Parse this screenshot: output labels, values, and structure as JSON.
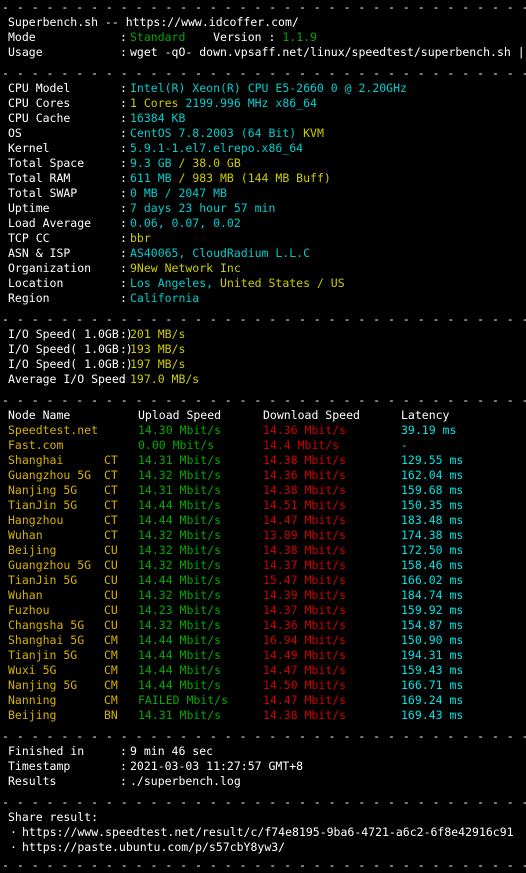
{
  "terminal": {
    "separator": "- - - - - - - - - - - - - - - - - - - - - - - - - - - - - - - - - - - - - -",
    "colors": {
      "background": "#000000",
      "foreground": "#ffffff",
      "cyan": "#00cdcd",
      "yellow": "#cdcd00",
      "green": "#00aa00",
      "red": "#cd0000",
      "bright_cyan": "#00e5e5",
      "node_name": "#d7b100"
    }
  },
  "header": {
    "title": "Superbench.sh -- https://www.idcoffer.com/",
    "mode_label": "Mode",
    "mode_value": "Standard",
    "version_label": "Version",
    "version_value": "1.1.9",
    "usage_label": "Usage",
    "usage_value": "wget -qO- down.vpsaff.net/linux/speedtest/superbench.sh | bash"
  },
  "sysinfo": [
    {
      "label": "CPU Model",
      "value_cyan": "Intel(R) Xeon(R) CPU E5-2660 0 @ 2.20GHz",
      "value_yellow": ""
    },
    {
      "label": "CPU Cores",
      "value_cyan": "",
      "value_yellow": "1 Cores",
      "value_cyan2": " 2199.996 MHz x86_64"
    },
    {
      "label": "CPU Cache",
      "value_cyan": "16384 KB",
      "value_yellow": ""
    },
    {
      "label": "OS",
      "value_cyan": "CentOS 7.8.2003 (64 Bit) ",
      "value_yellow": "KVM"
    },
    {
      "label": "Kernel",
      "value_cyan": "5.9.1-1.el7.elrepo.x86_64",
      "value_yellow": ""
    },
    {
      "label": "Total Space",
      "value_cyan": "9.3 GB ",
      "value_yellow": "/ 38.0 GB"
    },
    {
      "label": "Total RAM",
      "value_cyan": "611 MB ",
      "value_yellow": "/ 983 MB (144 MB Buff)"
    },
    {
      "label": "Total SWAP",
      "value_cyan": "0 MB / 2047 MB",
      "value_yellow": ""
    },
    {
      "label": "Uptime",
      "value_cyan": "7 days 23 hour 57 min",
      "value_yellow": ""
    },
    {
      "label": "Load Average",
      "value_cyan": "0.06, 0.07, 0.02",
      "value_yellow": ""
    },
    {
      "label": "TCP CC",
      "value_cyan": "",
      "value_yellow": "bbr"
    },
    {
      "label": "ASN & ISP",
      "value_cyan": "AS40065, CloudRadium L.L.C",
      "value_yellow": ""
    },
    {
      "label": "Organization",
      "value_cyan": "",
      "value_yellow": "9New Network Inc"
    },
    {
      "label": "Location",
      "value_cyan": "Los Angeles, ",
      "value_yellow": "United States / US"
    },
    {
      "label": "Region",
      "value_cyan": "California",
      "value_yellow": ""
    }
  ],
  "io": [
    {
      "label": "I/O Speed( 1.0GB )",
      "value": "201 MB/s"
    },
    {
      "label": "I/O Speed( 1.0GB )",
      "value": "193 MB/s"
    },
    {
      "label": "I/O Speed( 1.0GB )",
      "value": "197 MB/s"
    },
    {
      "label": "Average I/O Speed",
      "value": "197.0 MB/s"
    }
  ],
  "speedtest": {
    "columns": {
      "node": "Node Name",
      "upload": "Upload Speed",
      "download": "Download Speed",
      "latency": "Latency"
    },
    "rows": [
      {
        "node": "Speedtest.net",
        "isp": "",
        "upload": "14.30 Mbit/s",
        "download": "14.36 Mbit/s",
        "latency": "39.19 ms"
      },
      {
        "node": "Fast.com",
        "isp": "",
        "upload": "0.00 Mbit/s",
        "download": "14.4 Mbit/s",
        "latency": "-"
      },
      {
        "node": "Shanghai",
        "isp": "CT",
        "upload": "14.31 Mbit/s",
        "download": "14.38 Mbit/s",
        "latency": "129.55 ms"
      },
      {
        "node": "Guangzhou 5G",
        "isp": "CT",
        "upload": "14.32 Mbit/s",
        "download": "14.36 Mbit/s",
        "latency": "162.04 ms"
      },
      {
        "node": "Nanjing 5G",
        "isp": "CT",
        "upload": "14.31 Mbit/s",
        "download": "14.38 Mbit/s",
        "latency": "159.68 ms"
      },
      {
        "node": "TianJin 5G",
        "isp": "CT",
        "upload": "14.44 Mbit/s",
        "download": "14.51 Mbit/s",
        "latency": "150.35 ms"
      },
      {
        "node": "Hangzhou",
        "isp": "CT",
        "upload": "14.44 Mbit/s",
        "download": "14.47 Mbit/s",
        "latency": "183.48 ms"
      },
      {
        "node": "Wuhan",
        "isp": "CT",
        "upload": "14.32 Mbit/s",
        "download": "13.89 Mbit/s",
        "latency": "174.38 ms"
      },
      {
        "node": "Beijing",
        "isp": "CU",
        "upload": "14.32 Mbit/s",
        "download": "14.38 Mbit/s",
        "latency": "172.50 ms"
      },
      {
        "node": "Guangzhou 5G",
        "isp": "CU",
        "upload": "14.32 Mbit/s",
        "download": "14.37 Mbit/s",
        "latency": "158.46 ms"
      },
      {
        "node": "TianJin 5G",
        "isp": "CU",
        "upload": "14.44 Mbit/s",
        "download": "15.47 Mbit/s",
        "latency": "166.02 ms"
      },
      {
        "node": "Wuhan",
        "isp": "CU",
        "upload": "14.32 Mbit/s",
        "download": "14.39 Mbit/s",
        "latency": "184.74 ms"
      },
      {
        "node": "Fuzhou",
        "isp": "CU",
        "upload": "14.23 Mbit/s",
        "download": "14.37 Mbit/s",
        "latency": "159.92 ms"
      },
      {
        "node": "Changsha 5G",
        "isp": "CU",
        "upload": "14.32 Mbit/s",
        "download": "14.36 Mbit/s",
        "latency": "154.87 ms"
      },
      {
        "node": "Shanghai 5G",
        "isp": "CM",
        "upload": "14.44 Mbit/s",
        "download": "16.94 Mbit/s",
        "latency": "150.90 ms"
      },
      {
        "node": "Tianjin 5G",
        "isp": "CM",
        "upload": "14.44 Mbit/s",
        "download": "14.49 Mbit/s",
        "latency": "194.31 ms"
      },
      {
        "node": "Wuxi 5G",
        "isp": "CM",
        "upload": "14.44 Mbit/s",
        "download": "14.47 Mbit/s",
        "latency": "159.43 ms"
      },
      {
        "node": "Nanjing 5G",
        "isp": "CM",
        "upload": "14.44 Mbit/s",
        "download": "14.50 Mbit/s",
        "latency": "166.71 ms"
      },
      {
        "node": "Nanning",
        "isp": "CM",
        "upload": "FAILED Mbit/s",
        "download": "14.47 Mbit/s",
        "latency": "169.24 ms"
      },
      {
        "node": "Beijing",
        "isp": "BN",
        "upload": "14.31 Mbit/s",
        "download": "14.38 Mbit/s",
        "latency": "169.43 ms"
      }
    ]
  },
  "footer": {
    "finished_label": "Finished in",
    "finished_value": "9 min 46 sec",
    "timestamp_label": "Timestamp",
    "timestamp_value": "2021-03-03 11:27:57 GMT+8",
    "results_label": "Results",
    "results_value": "./superbench.log"
  },
  "share": {
    "title": "Share result:",
    "bullet": "·",
    "links": [
      "https://www.speedtest.net/result/c/f74e8195-9ba6-4721-a6c2-6f8e42916c91",
      "https://paste.ubuntu.com/p/s57cbY8yw3/"
    ]
  }
}
